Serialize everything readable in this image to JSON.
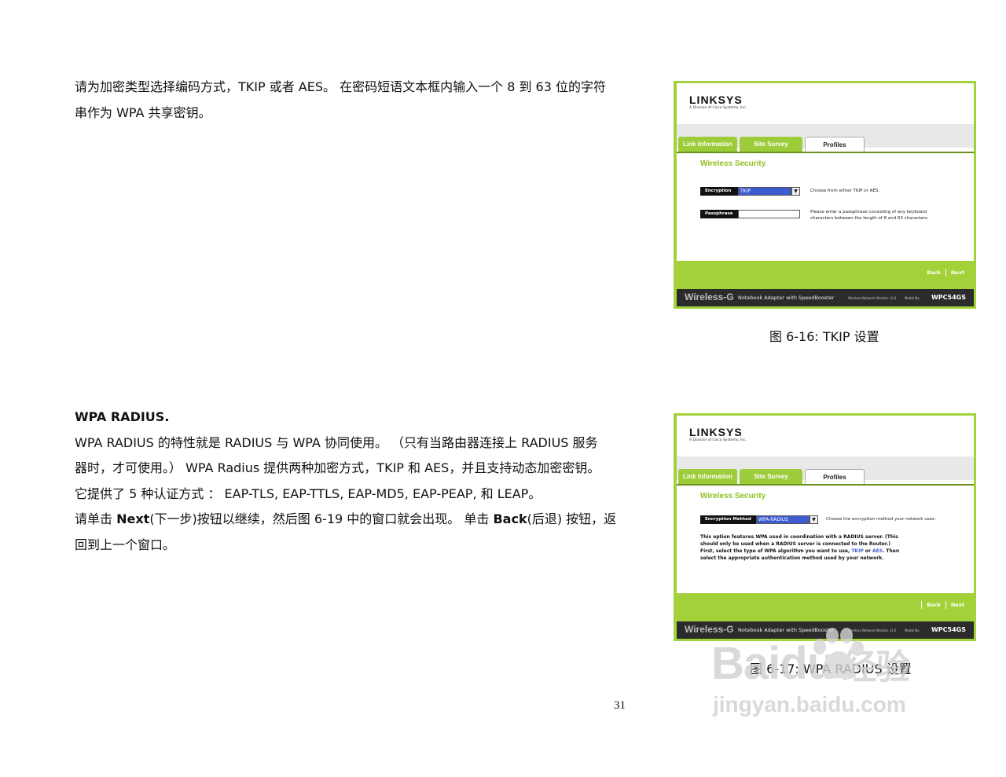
{
  "para1": {
    "line1": "请为加密类型选择编码方式，TKIP 或者 AES。 在密码短语文本框内输入一个 8 到 63 位的字符",
    "line2": "串作为 WPA 共享密钥。"
  },
  "figure1": {
    "logo": "LINKSYS",
    "logo_sub": "A Division of Cisco Systems, Inc.",
    "tabs": [
      "Link Information",
      "Site Survey",
      "Profiles"
    ],
    "section_title": "Wireless Security",
    "encryption_label": "Encryption",
    "encryption_value": "TKIP",
    "encryption_hint": "Choose from either TKIP or AES.",
    "passphrase_label": "Passphrase",
    "passphrase_value": "",
    "passphrase_hint": "Please enter a passphrase consisting of any keyboard characters between the length of 8 and 63 characters.",
    "back": "Back",
    "next": "Next",
    "footer_brand": "Wireless-G",
    "footer_product": "Notebook Adapter with SpeedBooster",
    "footer_monitor": "Wireless Network Monitor v1.0",
    "footer_model_label": "Model No.",
    "footer_model": "WPC54GS",
    "caption": "图  6-16: TKIP  设置"
  },
  "section2": {
    "heading": "WPA RADIUS.",
    "line1": "WPA RADIUS 的特性就是 RADIUS 与  WPA 协同使用。  （只有当路由器连接上 RADIUS 服务",
    "line2": "器时，才可使用。）  WPA Radius 提供两种加密方式，TKIP  和 AES，并且支持动态加密密钥。",
    "line3": "它提供了 5 种认证方式 ：  EAP-TLS, EAP-TTLS, EAP-MD5, EAP-PEAP,  和  LEAP。",
    "line4_a": "请单击 ",
    "line4_b": "Next",
    "line4_c": "(下一步)按钮以继续，然后图 6-19 中的窗口就会出现。 单击 ",
    "line4_d": "Back",
    "line4_e": "(后退)  按钮，返",
    "line5": "回到上一个窗口。"
  },
  "figure2": {
    "logo": "LINKSYS",
    "logo_sub": "A Division of Cisco Systems, Inc.",
    "tabs": [
      "Link Information",
      "Site Survey",
      "Profiles"
    ],
    "section_title": "Wireless Security",
    "method_label": "Encryption Method",
    "method_value": "WPA-RADIUS",
    "method_hint": "Choose the encryption method your network uses:",
    "desc_a": "This option features WPA used in coordination with a RADIUS server. (This should only be used when a RADIUS server is connected to the Router.) First, select the type of WPA algorithm you want to use, ",
    "desc_tkip": "TKIP",
    "desc_b": " or ",
    "desc_aes": "AES",
    "desc_c": ". Then select the appropriate authentication method used by your network.",
    "back": "Back",
    "next": "Next",
    "footer_brand": "Wireless-G",
    "footer_product": "Notebook Adapter with SpeedBooster",
    "footer_monitor": "Wireless Network Monitor v1.0",
    "footer_model_label": "Model No.",
    "footer_model": "WPC54GS",
    "caption": "图  6-17: WPA RADIUS  设置"
  },
  "page_number": "31",
  "watermark": {
    "main": "Bai",
    "main2": "du",
    "cn": "经验",
    "url": "jingyan.baidu.com"
  },
  "colors": {
    "linksys_green": "#a3d13a",
    "footer_dark": "#2b2b2b",
    "title_green": "#8fbf20"
  }
}
